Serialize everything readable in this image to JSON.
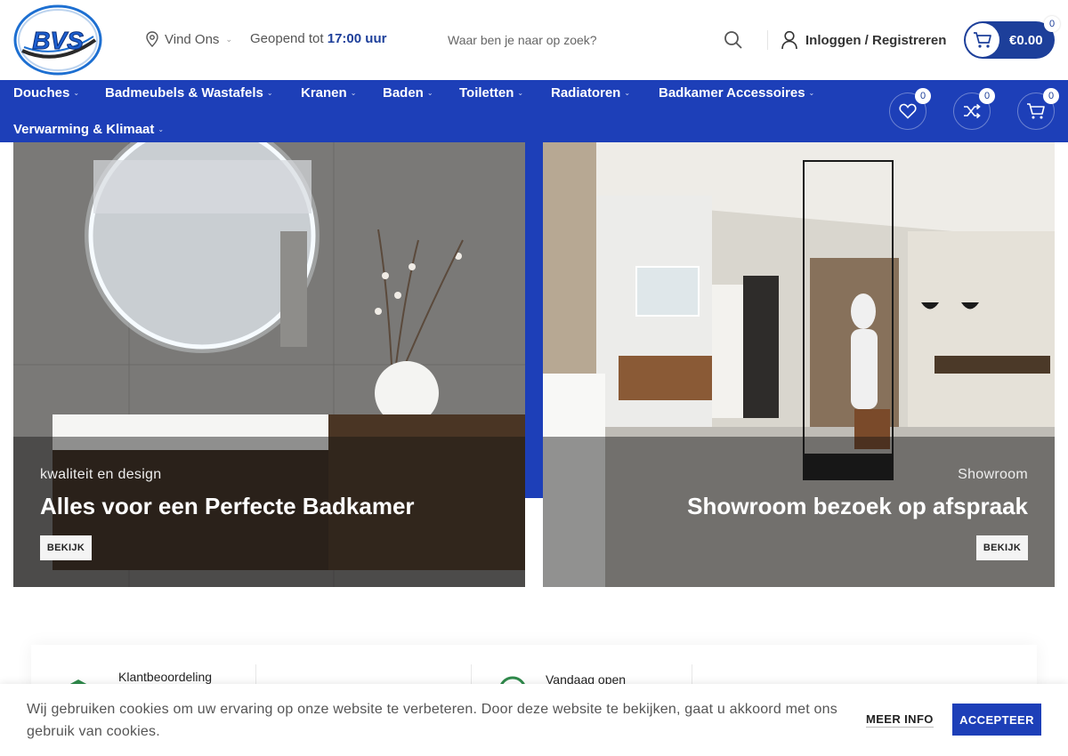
{
  "header": {
    "logo_text": "BVS",
    "find_us": "Vind Ons",
    "open_prefix": "Geopend tot",
    "open_time": "17:00 uur",
    "search_placeholder": "Waar ben je naar op zoek?",
    "login": "Inloggen / Registreren",
    "cart_total": "€0.00",
    "cart_count": "0"
  },
  "nav": {
    "items": [
      {
        "label": "Douches"
      },
      {
        "label": "Badmeubels & Wastafels"
      },
      {
        "label": "Kranen"
      },
      {
        "label": "Baden"
      },
      {
        "label": "Toiletten"
      },
      {
        "label": "Radiatoren"
      },
      {
        "label": "Badkamer Accessoires"
      },
      {
        "label": "Verwarming & Klimaat"
      }
    ],
    "wishlist_count": "0",
    "compare_count": "0",
    "cart_count": "0"
  },
  "banners": [
    {
      "subtitle": "kwaliteit en design",
      "title": "Alles voor een Perfecte Badkamer",
      "button": "BEKIJK"
    },
    {
      "subtitle": "Showroom",
      "title": "Showroom bezoek op afspraak",
      "button": "BEKIJK"
    }
  ],
  "info": {
    "rating_label": "Klantbeoordeling",
    "open_label": "Vandaag open"
  },
  "cookie": {
    "text": "Wij gebruiken cookies om uw ervaring op onze website te verbeteren. Door deze website te bekijken, gaat u akkoord met ons gebruik van cookies.",
    "more": "MEER INFO",
    "accept": "ACCEPTEER"
  },
  "colors": {
    "brand_blue": "#1d3fb8",
    "accent_dark_blue": "#1d3f9a"
  },
  "icons": [
    "location-pin-icon",
    "search-icon",
    "user-icon",
    "cart-icon",
    "heart-icon",
    "shuffle-icon",
    "chevron-down-icon"
  ]
}
